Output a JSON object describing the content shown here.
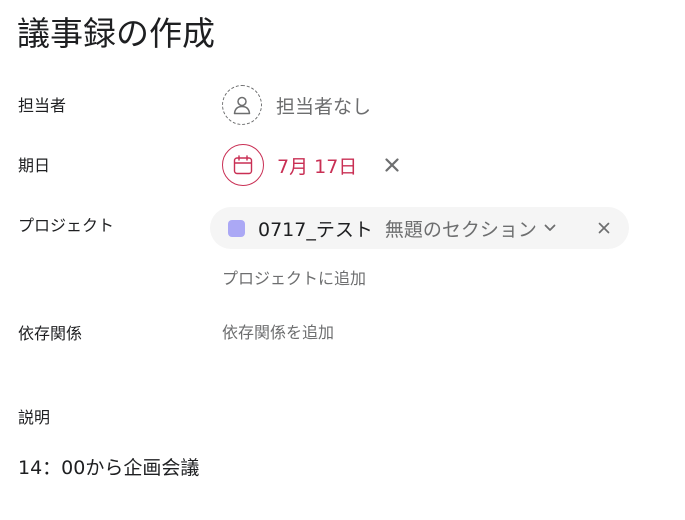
{
  "task": {
    "title": "議事録の作成"
  },
  "fields": {
    "assignee": {
      "label": "担当者",
      "value": "担当者なし",
      "icon": "person-icon"
    },
    "due_date": {
      "label": "期日",
      "value": "7月 17日",
      "icon": "calendar-icon",
      "clear_icon": "close-icon"
    },
    "projects": {
      "label": "プロジェクト",
      "items": [
        {
          "name": "0717_テスト",
          "section": "無題のセクション",
          "color": "#aba8f5"
        }
      ],
      "add_label": "プロジェクトに追加"
    },
    "dependencies": {
      "label": "依存関係",
      "add_label": "依存関係を追加"
    }
  },
  "description": {
    "label": "説明",
    "text": "14：00から企画会議"
  },
  "colors": {
    "text_primary": "#1e1f21",
    "text_secondary": "#6d6e6f",
    "due_date_accent": "#c92f54",
    "pill_background": "#f5f5f5"
  }
}
